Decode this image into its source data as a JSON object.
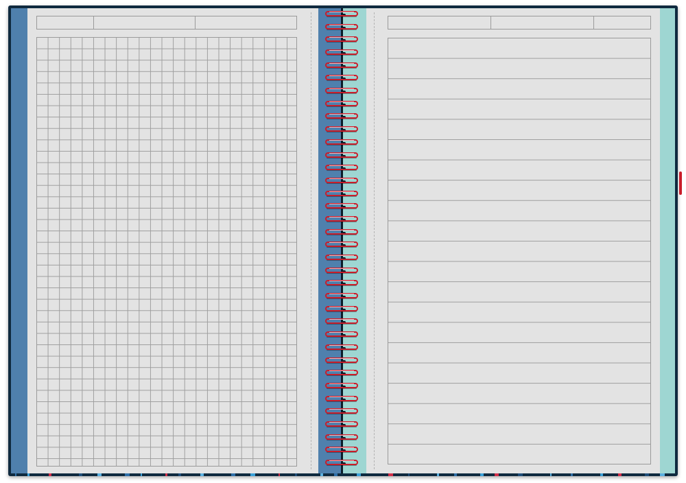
{
  "notebook": {
    "cover_color": "#0f2a3f",
    "left_band_color": "#4f80ad",
    "right_band_color": "#9ed6d2",
    "paper_color": "#e3e3e3",
    "rule_color": "#9e9e9e",
    "spiral_color": "#c91d2a",
    "left_page": {
      "ruling": "grid",
      "header_cells": 3,
      "grid_columns": 23,
      "grid_rows": 38
    },
    "right_page": {
      "ruling": "lined",
      "header_cells": 3,
      "line_count": 21
    },
    "spiral_rings": 36
  }
}
